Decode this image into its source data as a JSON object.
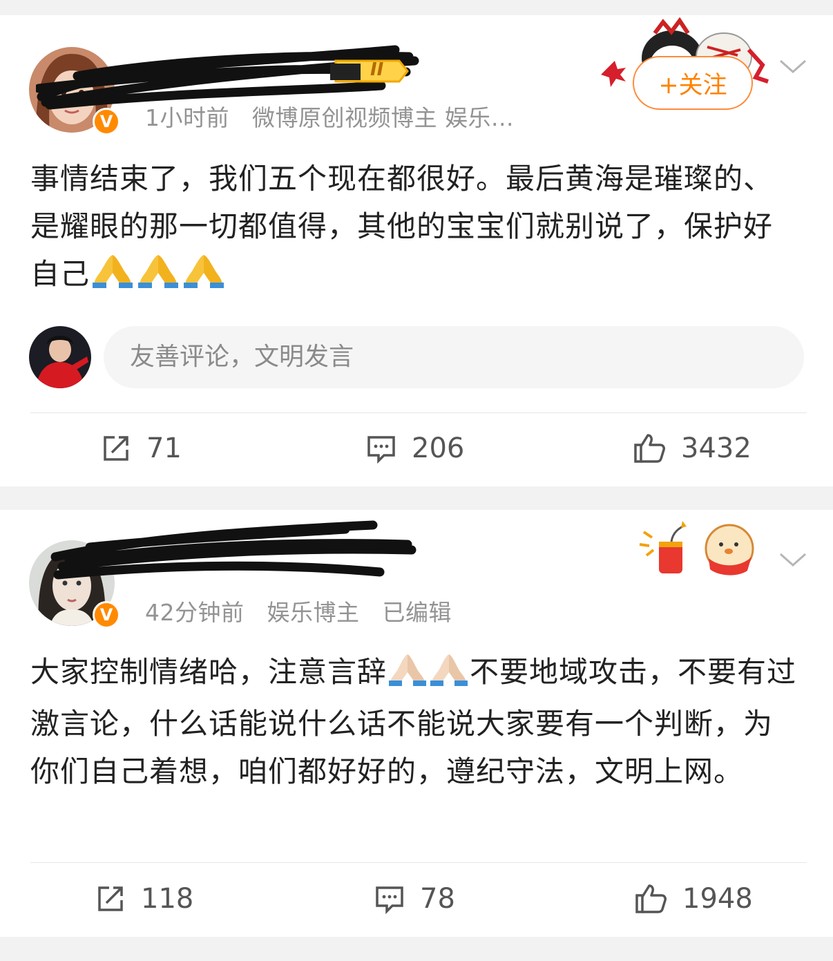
{
  "posts": [
    {
      "meta": {
        "time": "1小时前",
        "source": "微博原创视频博主 娱乐..."
      },
      "badge_level": "II",
      "follow_label": "+关注",
      "text": "事情结束了，我们五个现在都很好。最后黄海是璀璨的、是耀眼的那一切都值得，其他的宝宝们就别说了，保护好自己",
      "comment_placeholder": "友善评论，文明发言",
      "actions": {
        "repost": "71",
        "comment": "206",
        "like": "3432"
      }
    },
    {
      "meta": {
        "time": "42分钟前",
        "source": "娱乐博主",
        "edited": "已编辑"
      },
      "text_parts": [
        "大家控制情绪哈，注意言辞",
        "不要地域攻击，不要有过激言论，什么话能说什么话不能说大家要有一个判断，为你们自己着想，咱们都好好的，遵纪守法，文明上网。"
      ],
      "actions": {
        "repost": "118",
        "comment": "78",
        "like": "1948"
      }
    }
  ],
  "colors": {
    "accent": "#ff8200",
    "verified": "#ff8a00",
    "background": "#f2f2f2"
  }
}
